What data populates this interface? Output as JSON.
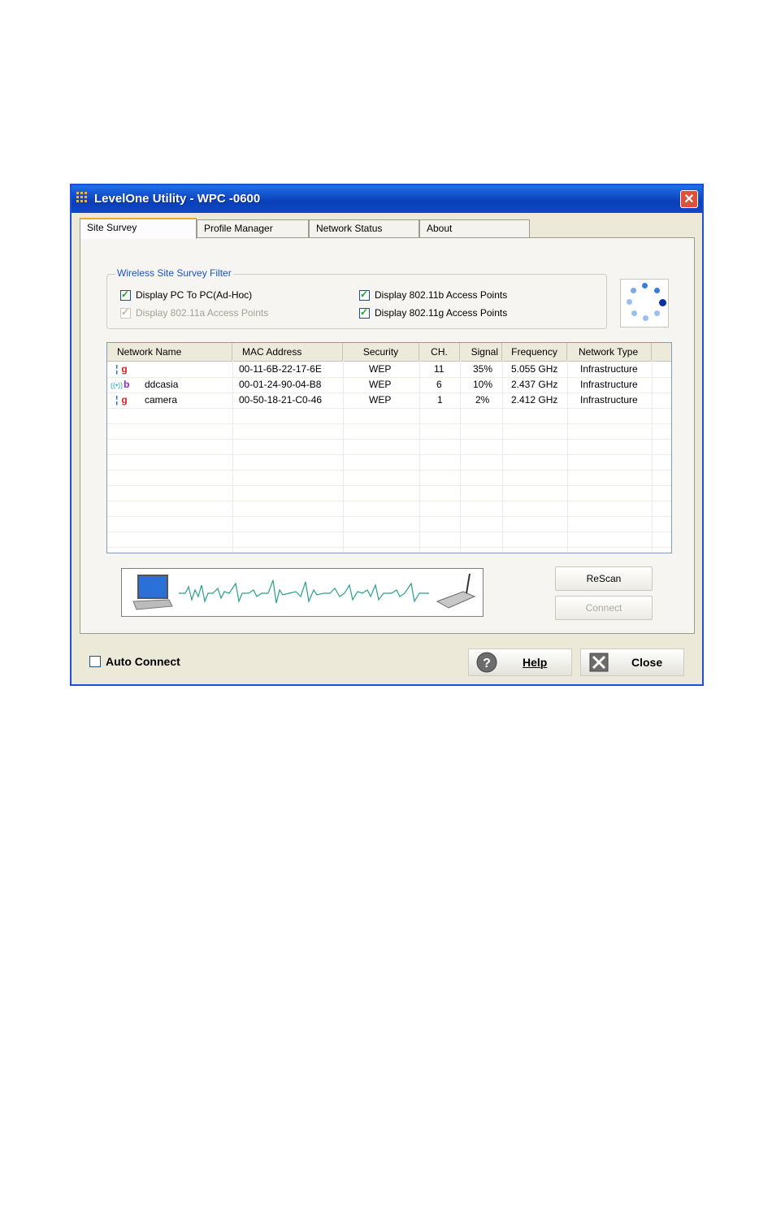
{
  "window": {
    "title": "LevelOne Utility - WPC -0600",
    "close_glyph": "✕"
  },
  "tabs": [
    {
      "label": "Site Survey",
      "active": true
    },
    {
      "label": "Profile Manager",
      "active": false
    },
    {
      "label": "Network Status",
      "active": false
    },
    {
      "label": "About",
      "active": false
    }
  ],
  "filter": {
    "legend": "Wireless Site Survey Filter",
    "options": [
      {
        "label": "Display PC To PC(Ad-Hoc)",
        "checked": true,
        "enabled": true
      },
      {
        "label": "Display 802.11a Access Points",
        "checked": true,
        "enabled": false
      },
      {
        "label": "Display 802.11b Access Points",
        "checked": true,
        "enabled": true
      },
      {
        "label": "Display 802.11g Access Points",
        "checked": true,
        "enabled": true
      }
    ]
  },
  "table": {
    "columns": [
      "Network Name",
      "MAC Address",
      "Security",
      "CH.",
      "Signal",
      "Frequency",
      "Network Type"
    ],
    "rows": [
      {
        "band": "g",
        "name": "",
        "mac": "00-11-6B-22-17-6E",
        "security": "WEP",
        "channel": "11",
        "signal": "35%",
        "frequency": "5.055 GHz",
        "type": "Infrastructure"
      },
      {
        "band": "b",
        "name": "ddcasia",
        "mac": "00-01-24-90-04-B8",
        "security": "WEP",
        "channel": "6",
        "signal": "10%",
        "frequency": "2.437 GHz",
        "type": "Infrastructure"
      },
      {
        "band": "g",
        "name": "camera",
        "mac": "00-50-18-21-C0-46",
        "security": "WEP",
        "channel": "1",
        "signal": "2%",
        "frequency": "2.412 GHz",
        "type": "Infrastructure"
      }
    ]
  },
  "buttons": {
    "rescan": "ReScan",
    "connect": "Connect",
    "help": "Help",
    "close": "Close"
  },
  "auto_connect": {
    "label": "Auto Connect",
    "checked": false
  },
  "colors": {
    "title_blue": "#0a3fb8",
    "tab_accent": "#f5a623",
    "band_g": "#e02020",
    "band_b": "#8a2be2"
  }
}
